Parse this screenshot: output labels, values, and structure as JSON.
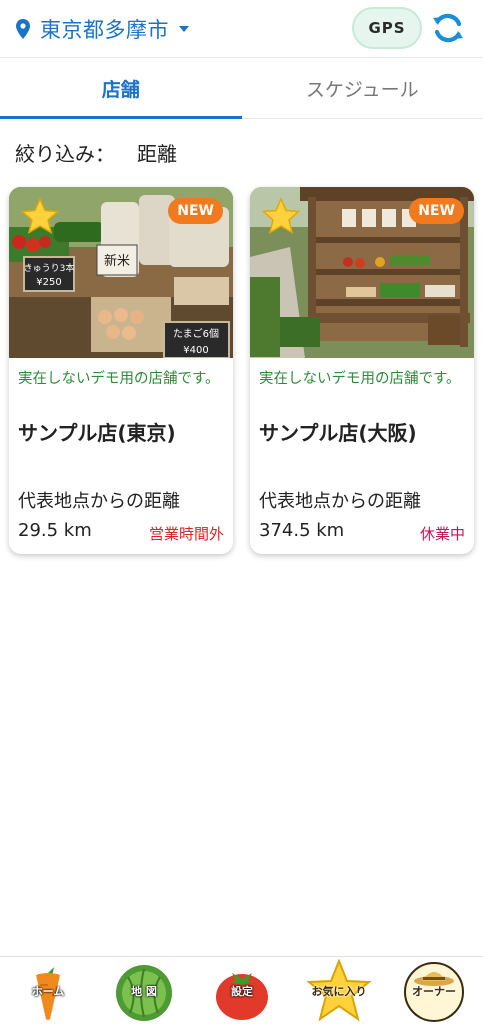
{
  "header": {
    "location": "東京都多摩市",
    "gps_label": "GPS",
    "pin_icon": "location-pin-icon",
    "refresh_icon": "refresh-icon",
    "accent": "#1a73c8"
  },
  "tabs": [
    {
      "label": "店舗",
      "active": true
    },
    {
      "label": "スケジュール",
      "active": false
    }
  ],
  "filter": {
    "label": "絞り込み：",
    "value": "距離"
  },
  "shops": [
    {
      "badge": "NEW",
      "note": "実在しないデモ用の店舗です。",
      "name": "サンプル店(東京)",
      "distance_label": "代表地点からの距離",
      "distance": "29.5 km",
      "status": "営業時間外",
      "status_color": "#d8262b",
      "photo_signs": [
        "きゅうり3本",
        "¥250",
        "新米",
        "たまご6個",
        "¥400"
      ]
    },
    {
      "badge": "NEW",
      "note": "実在しないデモ用の店舗です。",
      "name": "サンプル店(大阪)",
      "distance_label": "代表地点からの距離",
      "distance": "374.5 km",
      "status": "休業中",
      "status_color": "#c2185b",
      "photo_signs": []
    }
  ],
  "bottom_nav": [
    {
      "label": "ホーム",
      "icon": "carrot-icon"
    },
    {
      "label": "地 図",
      "icon": "cabbage-icon"
    },
    {
      "label": "設定",
      "icon": "tomato-icon"
    },
    {
      "label": "お気に入り",
      "icon": "star-icon"
    },
    {
      "label": "オーナー",
      "icon": "farmer-hat-icon"
    }
  ]
}
